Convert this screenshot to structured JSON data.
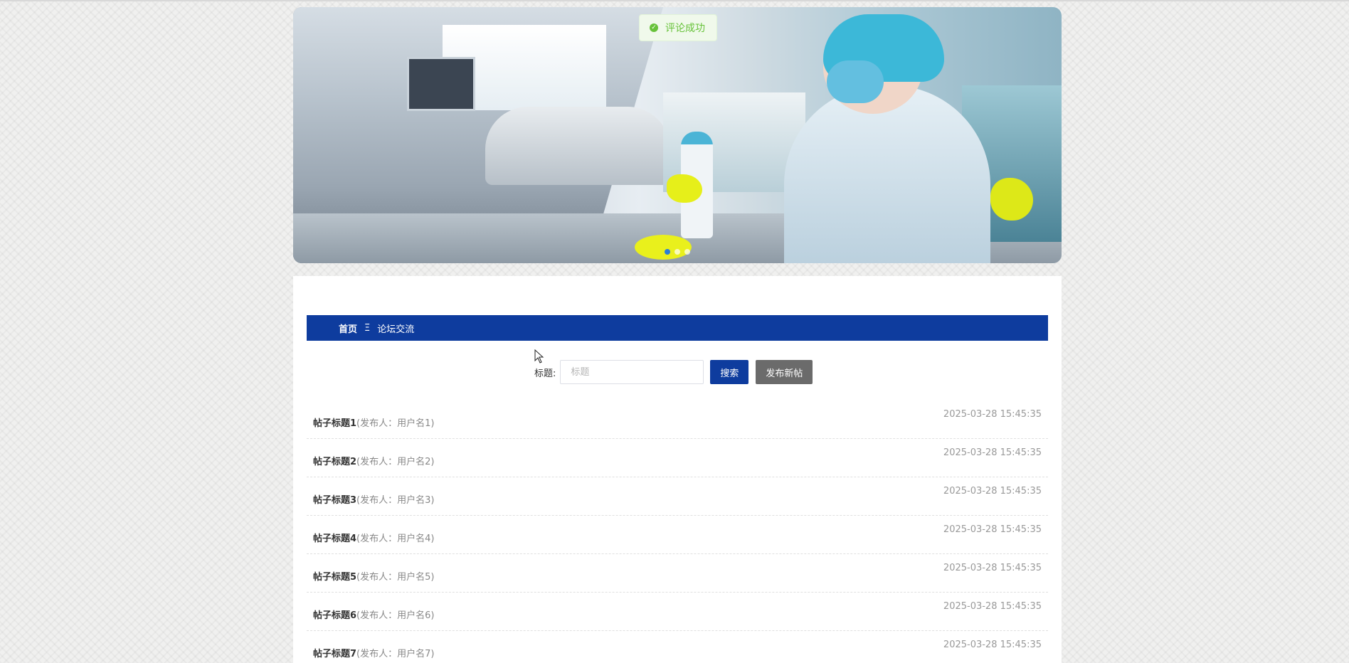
{
  "toast": {
    "message": "评论成功"
  },
  "breadcrumb": {
    "home": "首页",
    "separator": "Ξ",
    "current": "论坛交流"
  },
  "search": {
    "label": "标题:",
    "placeholder": "标题",
    "value": "",
    "search_button": "搜索",
    "new_post_button": "发布新帖"
  },
  "banner": {
    "slide_count": 3,
    "active_slide": 1
  },
  "posts": [
    {
      "title": "帖子标题1",
      "author": "(发布人：用户名1)",
      "time": "2025-03-28 15:45:35"
    },
    {
      "title": "帖子标题2",
      "author": "(发布人：用户名2)",
      "time": "2025-03-28 15:45:35"
    },
    {
      "title": "帖子标题3",
      "author": "(发布人：用户名3)",
      "time": "2025-03-28 15:45:35"
    },
    {
      "title": "帖子标题4",
      "author": "(发布人：用户名4)",
      "time": "2025-03-28 15:45:35"
    },
    {
      "title": "帖子标题5",
      "author": "(发布人：用户名5)",
      "time": "2025-03-28 15:45:35"
    },
    {
      "title": "帖子标题6",
      "author": "(发布人：用户名6)",
      "time": "2025-03-28 15:45:35"
    },
    {
      "title": "帖子标题7",
      "author": "(发布人：用户名7)",
      "time": "2025-03-28 15:45:35"
    }
  ],
  "colors": {
    "primary": "#0e3c9e",
    "secondary_button": "#6b6b6b",
    "toast_text": "#67c23a",
    "toast_bg": "#f0f9eb"
  }
}
